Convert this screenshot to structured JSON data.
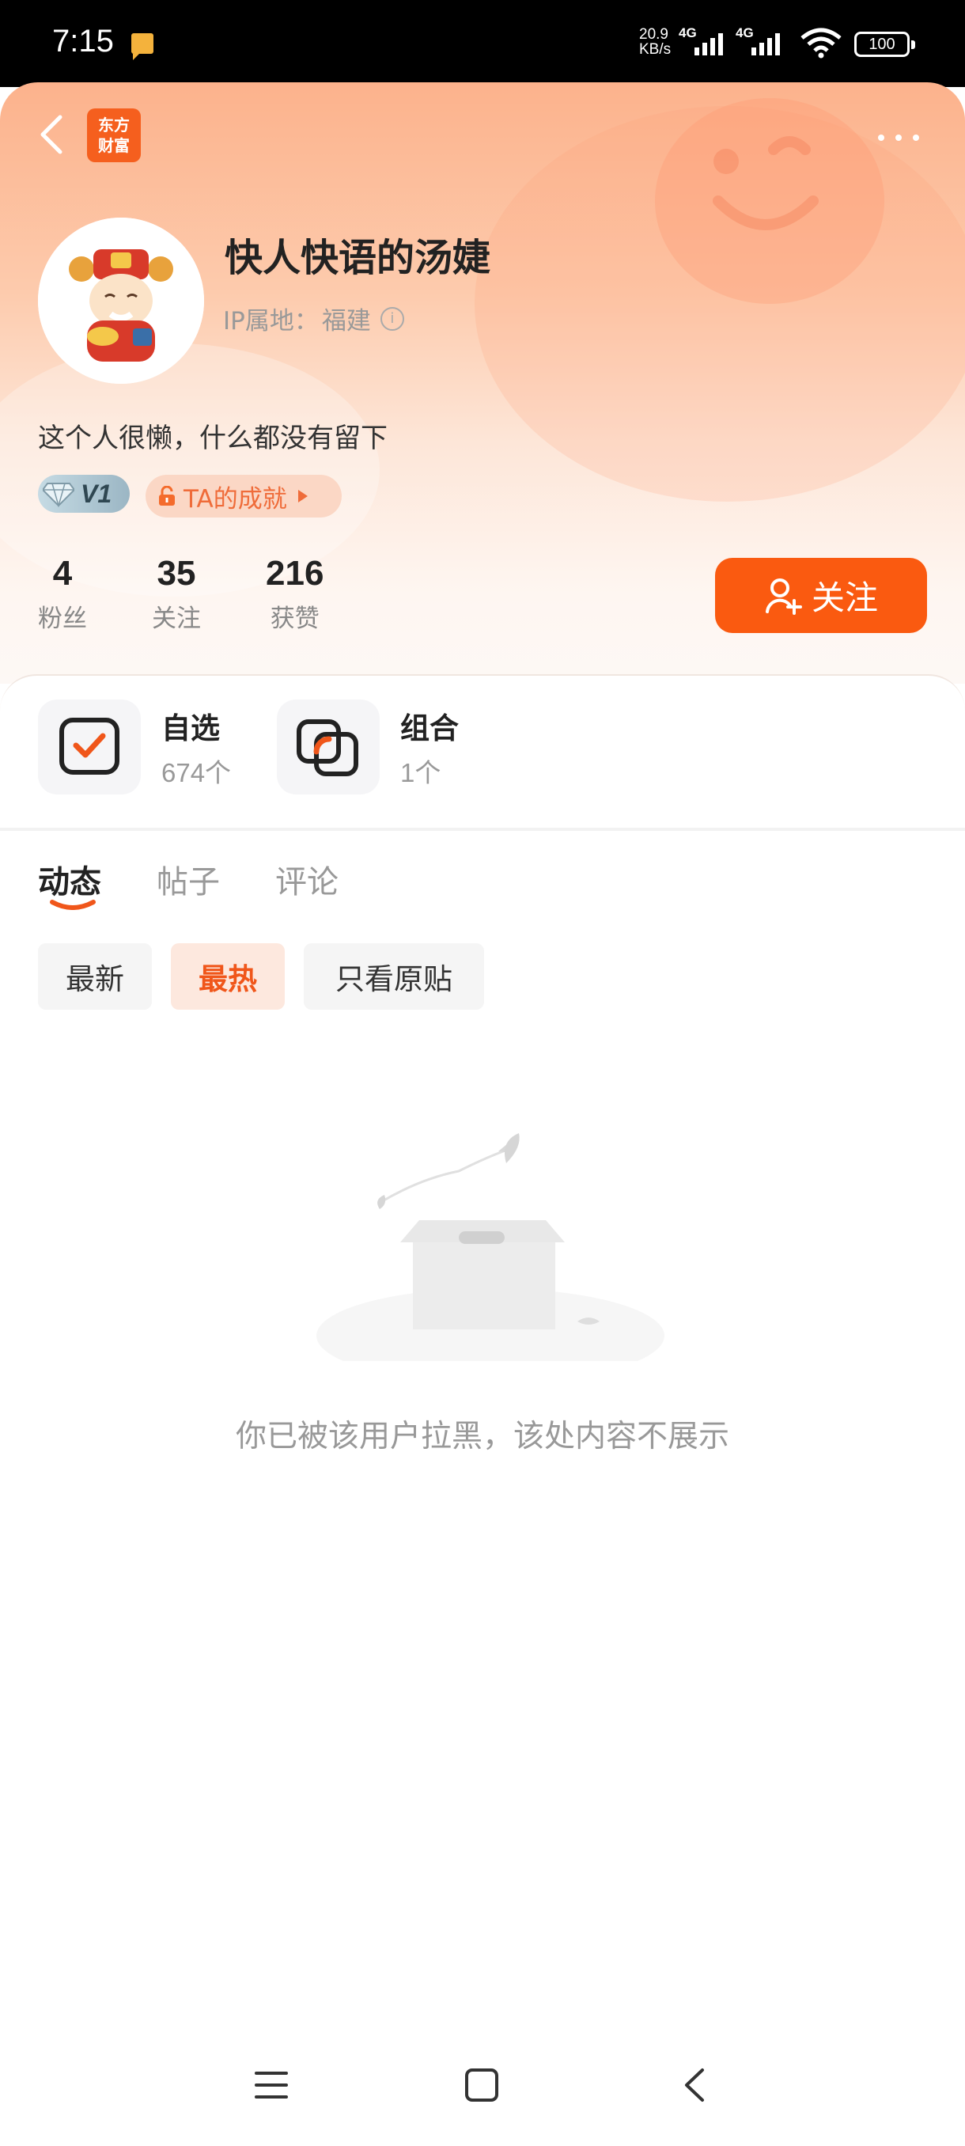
{
  "status_bar": {
    "time": "7:15",
    "net_speed_value": "20.9",
    "net_speed_unit": "KB/s",
    "signal1": "4G",
    "signal2": "4G",
    "battery": "100",
    "notification_color": "#f4b23c"
  },
  "header": {
    "logo_line1": "东方",
    "logo_line2": "财富",
    "back_icon": "chevron-left-icon",
    "more_icon": "more-dots-icon"
  },
  "profile": {
    "username": "快人快语的汤婕",
    "ip_label": "IP属地：",
    "ip_location": "福建",
    "bio": "这个人很懒，什么都没有留下",
    "vip_level": "V1",
    "achievement_label": "TA的成就",
    "stats": [
      {
        "value": "4",
        "label": "粉丝"
      },
      {
        "value": "35",
        "label": "关注"
      },
      {
        "value": "216",
        "label": "获赞"
      }
    ],
    "follow_button": "关注"
  },
  "functions": [
    {
      "title": "自选",
      "sub": "674个",
      "icon": "watchlist-check-icon"
    },
    {
      "title": "组合",
      "sub": "1个",
      "icon": "portfolio-combine-icon"
    }
  ],
  "tabs": [
    "动态",
    "帖子",
    "评论"
  ],
  "active_tab": "动态",
  "filters": [
    "最新",
    "最热",
    "只看原贴"
  ],
  "active_filter": "最热",
  "empty_message": "你已被该用户拉黑，该处内容不展示",
  "nav_bar": {
    "menu_icon": "menu-icon",
    "home_icon": "home-square-icon",
    "back_icon": "back-triangle-icon"
  },
  "colors": {
    "accent": "#fa5a10",
    "accent_text": "#f0561a",
    "gradient_top": "#fcb28c"
  }
}
